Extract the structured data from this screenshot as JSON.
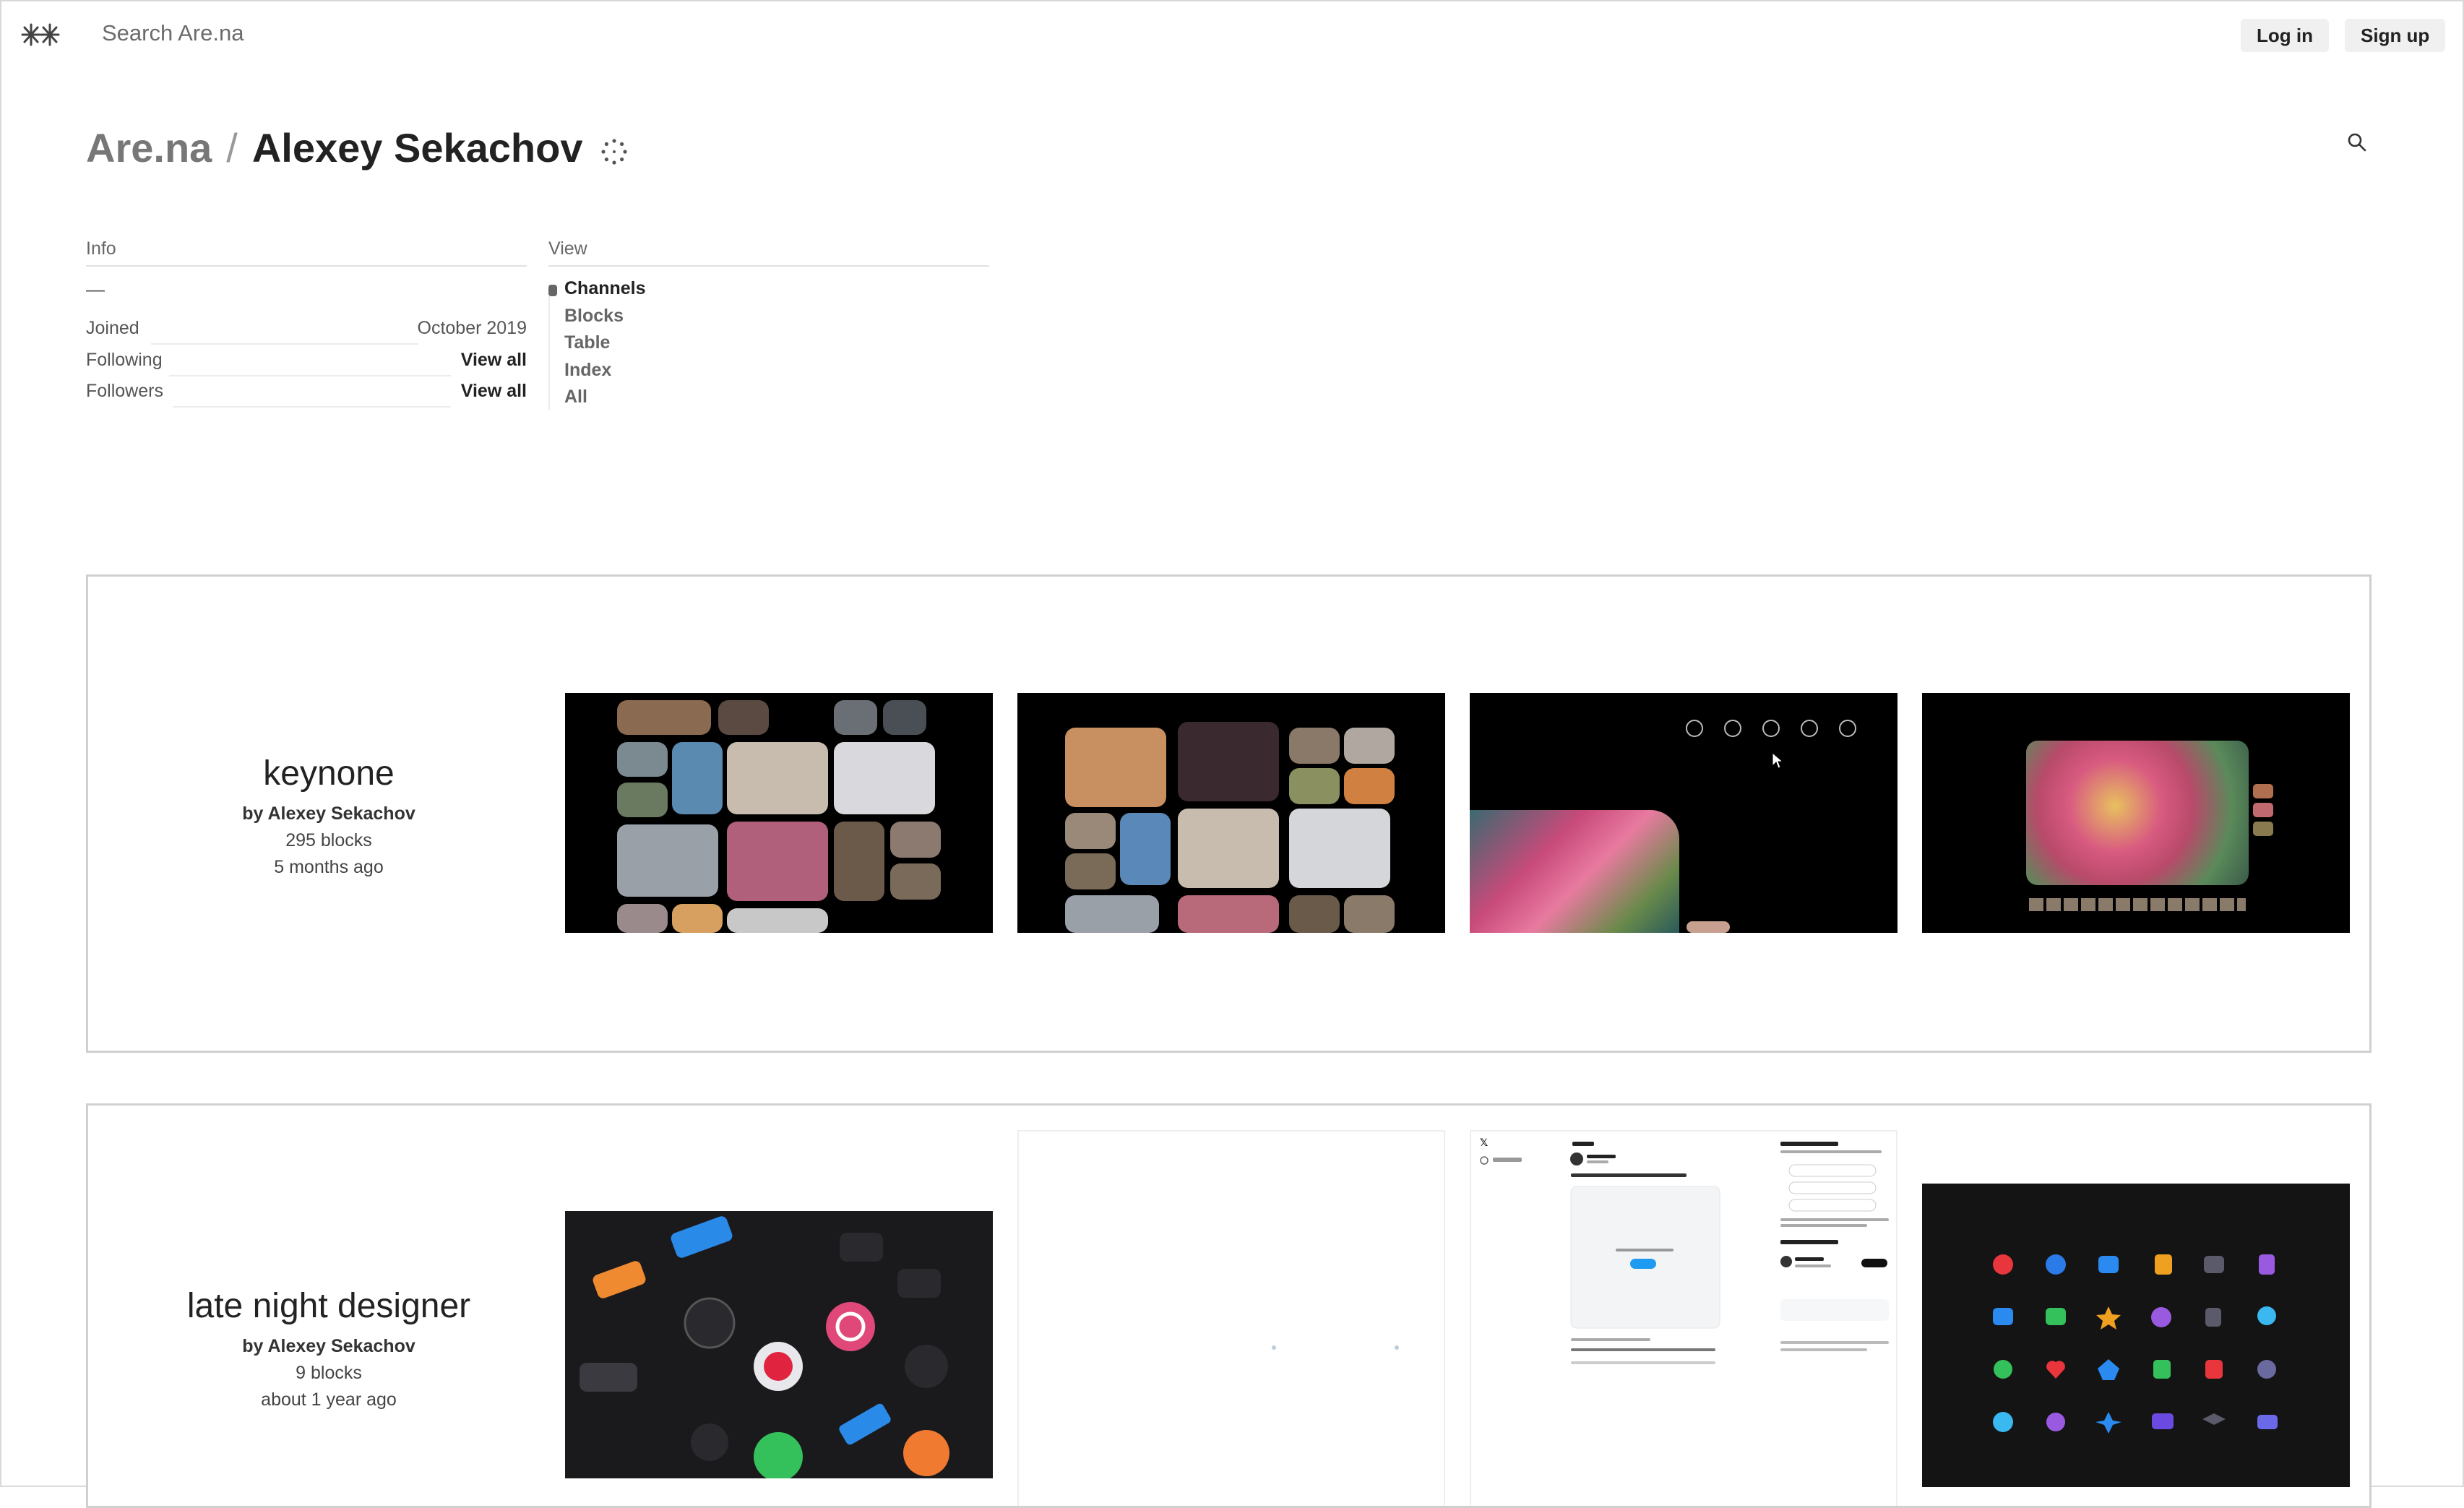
{
  "topbar": {
    "search_placeholder": "Search Are.na",
    "login_label": "Log in",
    "signup_label": "Sign up"
  },
  "breadcrumb": {
    "root": "Are.na",
    "separator": "/",
    "user": "Alexey Sekachov"
  },
  "info": {
    "heading": "Info",
    "bio": "—",
    "joined_label": "Joined",
    "joined_value": "October 2019",
    "following_label": "Following",
    "following_action": "View all",
    "followers_label": "Followers",
    "followers_action": "View all"
  },
  "view": {
    "heading": "View",
    "items": [
      {
        "label": "Channels",
        "active": true
      },
      {
        "label": "Blocks",
        "active": false
      },
      {
        "label": "Table",
        "active": false
      },
      {
        "label": "Index",
        "active": false
      },
      {
        "label": "All",
        "active": false
      }
    ]
  },
  "channels": [
    {
      "title": "keynone",
      "byline": "by Alexey Sekachov",
      "blocks": "295 blocks",
      "updated": "5 months ago"
    },
    {
      "title": "late night designer",
      "byline": "by Alexey Sekachov",
      "blocks": "9 blocks",
      "updated": "about 1 year ago"
    }
  ],
  "colors": {
    "text_primary": "#222222",
    "text_muted": "#777777",
    "card_border": "#d0d0d0",
    "button_bg": "#f0f0f0"
  },
  "icons": {
    "logo": "arena-logo-icon",
    "profile": "dotted-circle-icon",
    "search": "search-icon"
  }
}
